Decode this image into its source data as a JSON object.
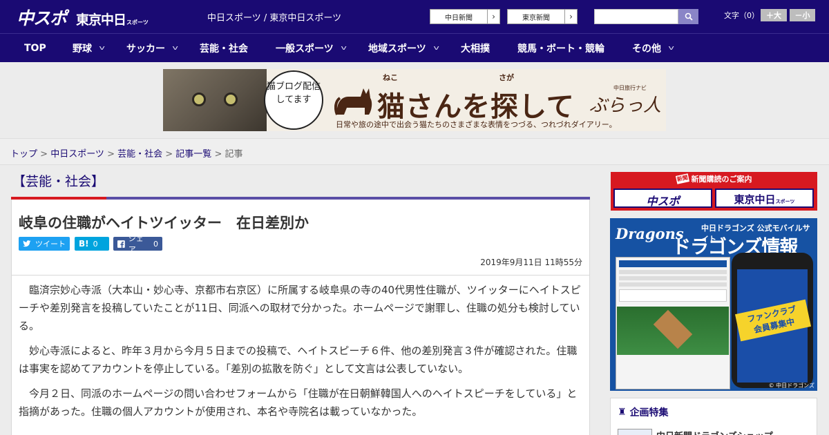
{
  "header": {
    "logo_main": "中スポ",
    "logo_tokyo": "東京中日",
    "logo_tokyo_small": "スポーツ",
    "site_names": "中日スポーツ / 東京中日スポーツ",
    "ext_links": [
      {
        "label": "中日新聞",
        "arrow": "›"
      },
      {
        "label": "東京新聞",
        "arrow": "›"
      }
    ],
    "search": {
      "placeholder": "",
      "icon": "search-icon"
    },
    "font_size": {
      "label": "文字（0）",
      "bigger": "＋大",
      "smaller": "－小"
    }
  },
  "nav": {
    "items": [
      {
        "label": "TOP",
        "chevron": ""
      },
      {
        "label": "野球",
        "chevron": "v"
      },
      {
        "label": "サッカー",
        "chevron": "v"
      },
      {
        "label": "芸能・社会",
        "chevron": ""
      },
      {
        "label": "一般スポーツ",
        "chevron": "v"
      },
      {
        "label": "地域スポーツ",
        "chevron": "v"
      },
      {
        "label": "大相撲",
        "chevron": ""
      },
      {
        "label": "競馬・ボート・競輪",
        "chevron": ""
      },
      {
        "label": "その他",
        "chevron": "v"
      }
    ]
  },
  "banner": {
    "bubble": "猫ブログ配信してます",
    "title": "猫さんを探して",
    "ruby_neko": "ねこ",
    "ruby_saga": "さが",
    "subtitle": "日常や旅の途中で出会う猫たちのさまざまな表情をつづる、つれづれダイアリー。",
    "brand_small": "中日旅行ナビ",
    "brand": "ぶらっ人"
  },
  "breadcrumb": {
    "items": [
      "トップ",
      "中日スポーツ",
      "芸能・社会",
      "記事一覧"
    ],
    "current": "記事",
    "separator": " > "
  },
  "article": {
    "category": "【芸能・社会】",
    "title": "岐阜の住職がヘイトツイッター　在日差別か",
    "share": {
      "twitter": "ツイート",
      "hatena_icon": "B!",
      "hatena_count": "0",
      "facebook": "シェア",
      "facebook_count": "0"
    },
    "date": "2019年9月11日 11時55分",
    "paragraphs": [
      "臨済宗妙心寺派（大本山・妙心寺、京都市右京区）に所属する岐阜県の寺の40代男性住職が、ツイッターにヘイトスピーチや差別発言を投稿していたことが11日、同派への取材で分かった。ホームページで謝罪し、住職の処分も検討している。",
      "妙心寺派によると、昨年３月から今月５日までの投稿で、ヘイトスピーチ６件、他の差別発言３件が確認された。住職は事実を認めてアカウントを停止している。「差別の拡散を防ぐ」として文言は公表していない。",
      "今月２日、同派のホームページの問い合わせフォームから「住職が在日朝鮮韓国人へのヘイトスピーチをしている」と指摘があった。住職の個人アカウントが使用され、本名や寺院名は載っていなかった。"
    ]
  },
  "sidebar": {
    "subscription": {
      "head": "新聞購読のご案内",
      "logo_chuspo": "中スポ",
      "logo_tokyo": "東京中日",
      "logo_tokyo_small": "スポーツ"
    },
    "dragons_ad": {
      "logo": "Dragons",
      "sub": "中日ドラゴンズ 公式モバイルサイト",
      "main": "ドラゴンズ情報",
      "badge_line1": "ファンクラブ",
      "badge_line2": "会員募集中",
      "copyright": "© 中日ドラゴンズ"
    },
    "feature": {
      "head": "企画特集",
      "item": "中日新聞ドラゴンズショップ"
    }
  },
  "colors": {
    "header_bg": "#1a0a73",
    "accent_red": "#d71920",
    "twitter": "#1da1f2",
    "hatena": "#00a4de",
    "facebook": "#3b5998"
  }
}
